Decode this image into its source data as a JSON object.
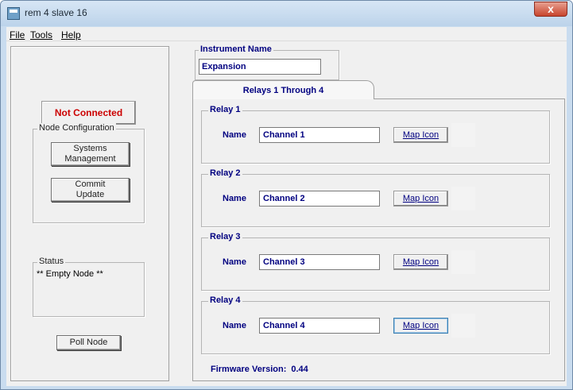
{
  "window": {
    "title": "rem 4 slave 16",
    "close_glyph": "x"
  },
  "menu": {
    "file": "File",
    "tools": "Tools",
    "help": "Help"
  },
  "left": {
    "connection_status": "Not Connected",
    "node_config_label": "Node Configuration",
    "systems_management": "Systems\nManagement",
    "commit_update": "Commit\nUpdate",
    "status_label": "Status",
    "status_text": "** Empty Node **",
    "poll_node": "Poll Node"
  },
  "instrument": {
    "label": "Instrument Name",
    "value": "Expansion"
  },
  "tab": {
    "label": "Relays 1 Through 4"
  },
  "relays": [
    {
      "title": "Relay 1",
      "name_label": "Name",
      "value": "Channel 1",
      "map_icon": "Map Icon"
    },
    {
      "title": "Relay 2",
      "name_label": "Name",
      "value": "Channel 2",
      "map_icon": "Map Icon"
    },
    {
      "title": "Relay 3",
      "name_label": "Name",
      "value": "Channel 3",
      "map_icon": "Map Icon"
    },
    {
      "title": "Relay 4",
      "name_label": "Name",
      "value": "Channel 4",
      "map_icon": "Map Icon"
    }
  ],
  "firmware": {
    "label": "Firmware Version:",
    "version": "0.44"
  },
  "colors": {
    "label_navy": "#000080",
    "status_red": "#cc0000"
  },
  "icons": {
    "app": "app-icon",
    "close": "close-icon"
  }
}
